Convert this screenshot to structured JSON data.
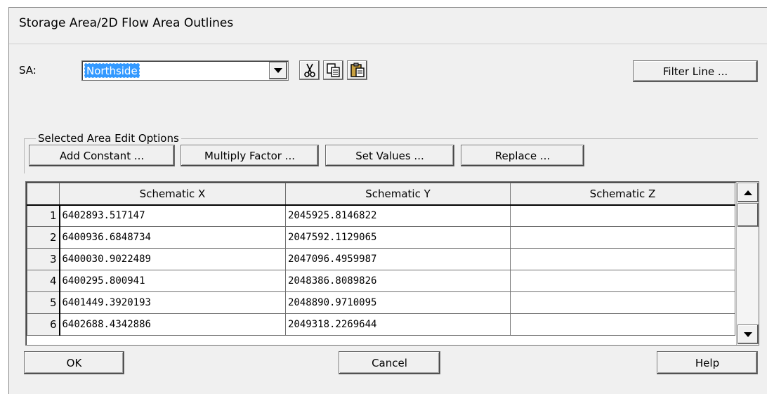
{
  "window": {
    "title": "Storage Area/2D Flow Area Outlines"
  },
  "selector": {
    "label": "SA:",
    "value": "Northside"
  },
  "toolbar": {
    "filter_label": "Filter Line ..."
  },
  "edit_options": {
    "group_label": "Selected Area Edit Options",
    "buttons": [
      "Add Constant ...",
      "Multiply Factor ...",
      "Set Values ...",
      "Replace ..."
    ]
  },
  "grid": {
    "columns": [
      "Schematic X",
      "Schematic Y",
      "Schematic Z"
    ],
    "rows": [
      {
        "num": "1",
        "x": "6402893.517147",
        "y": "2045925.8146822",
        "z": ""
      },
      {
        "num": "2",
        "x": "6400936.6848734",
        "y": "2047592.1129065",
        "z": ""
      },
      {
        "num": "3",
        "x": "6400030.9022489",
        "y": "2047096.4959987",
        "z": ""
      },
      {
        "num": "4",
        "x": "6400295.800941",
        "y": "2048386.8089826",
        "z": ""
      },
      {
        "num": "5",
        "x": "6401449.3920193",
        "y": "2048890.9710095",
        "z": ""
      },
      {
        "num": "6",
        "x": "6402688.4342886",
        "y": "2049318.2269644",
        "z": ""
      }
    ]
  },
  "footer": {
    "ok_label": "OK",
    "cancel_label": "Cancel",
    "help_label": "Help"
  }
}
